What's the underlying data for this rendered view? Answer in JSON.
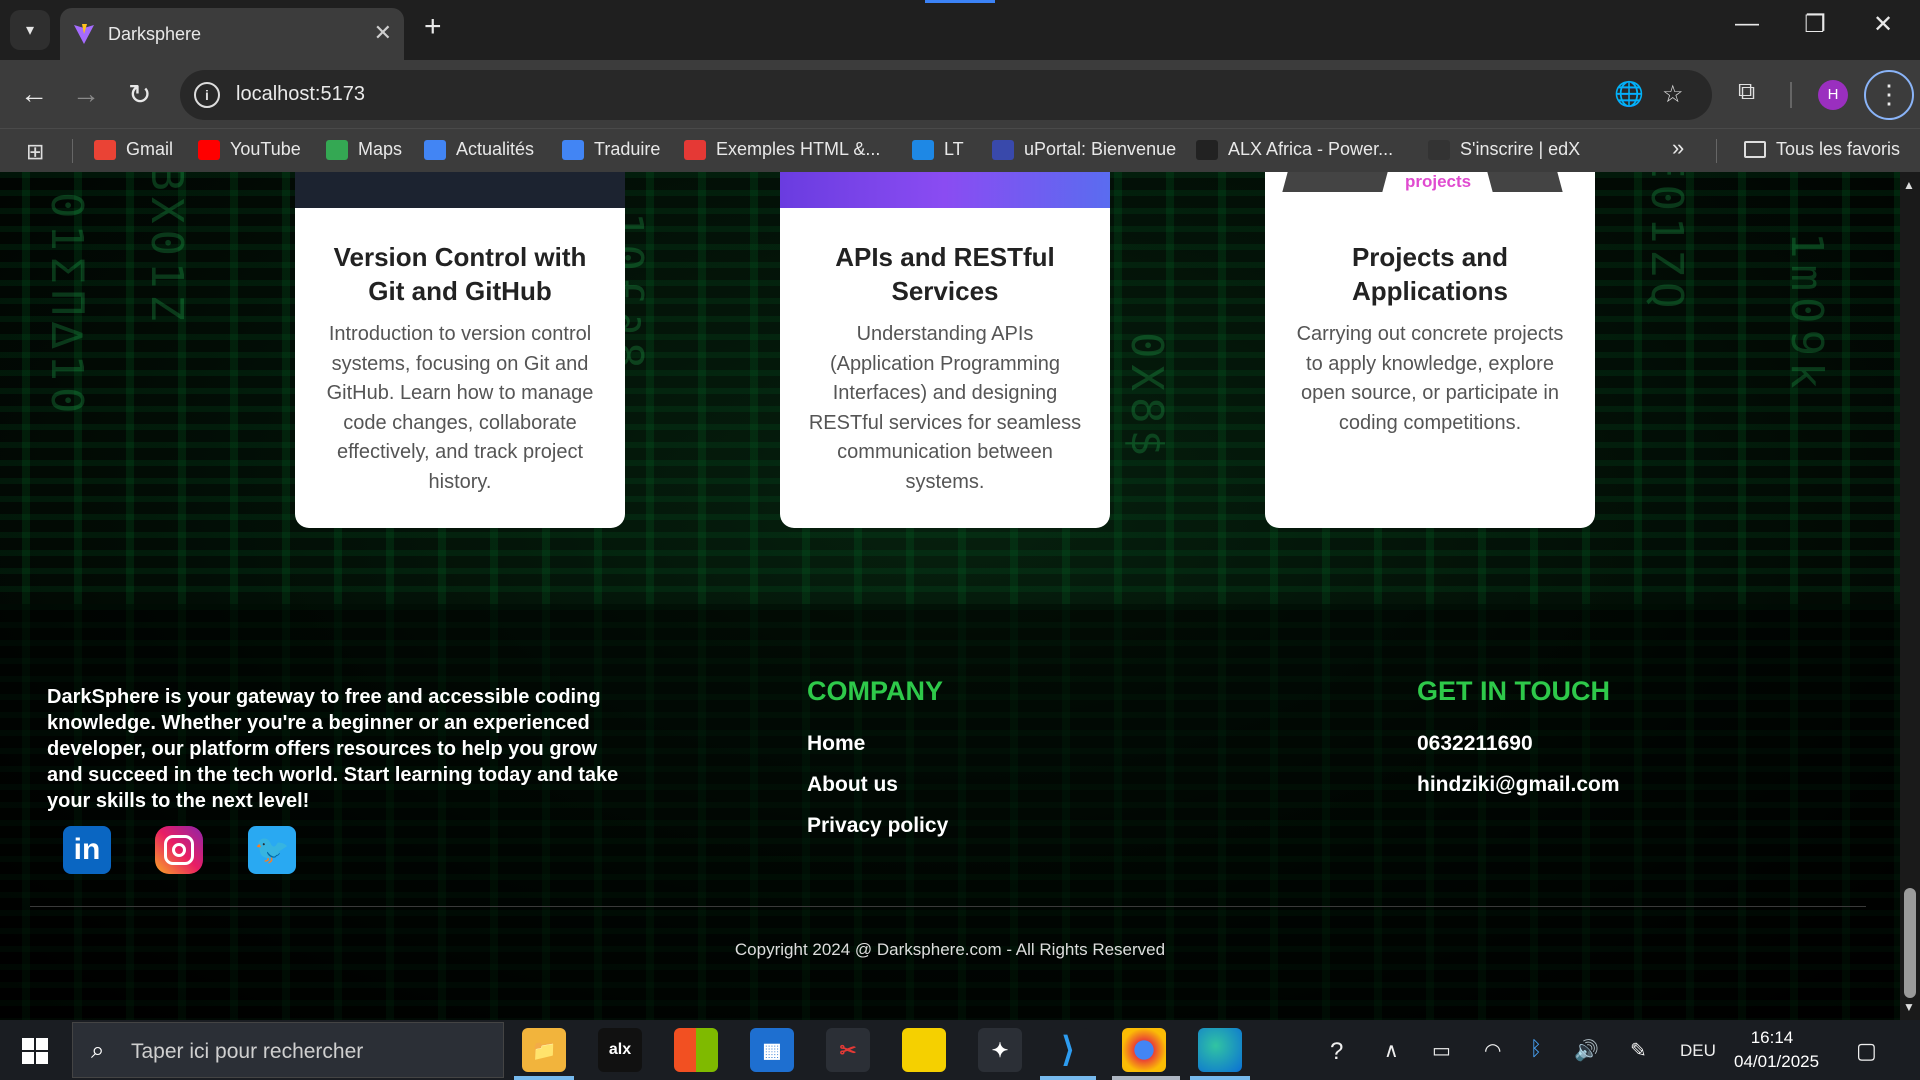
{
  "browser": {
    "tab_title": "Darksphere",
    "url": "localhost:5173",
    "avatar_letter": "H",
    "bookmarks": [
      {
        "label": "Gmail",
        "icon": "gmail-icon",
        "color": "#ea4335"
      },
      {
        "label": "YouTube",
        "icon": "youtube-icon",
        "color": "#ff0000"
      },
      {
        "label": "Maps",
        "icon": "maps-icon",
        "color": "#34a853"
      },
      {
        "label": "Actualités",
        "icon": "news-icon",
        "color": "#4285f4"
      },
      {
        "label": "Traduire",
        "icon": "translate-icon",
        "color": "#4285f4"
      },
      {
        "label": "Exemples HTML &...",
        "icon": "bookmark-red-icon",
        "color": "#e53935"
      },
      {
        "label": "LT",
        "icon": "lt-icon",
        "color": "#1e88e5"
      },
      {
        "label": "uPortal: Bienvenue",
        "icon": "uportal-icon",
        "color": "#3949ab"
      },
      {
        "label": "ALX Africa - Power...",
        "icon": "alx-icon",
        "color": "#222222"
      },
      {
        "label": "S'inscrire | edX",
        "icon": "edx-icon",
        "color": "#333333"
      }
    ],
    "overflow_label": "»",
    "all_bookmarks_label": "Tous les favoris"
  },
  "cards": [
    {
      "title": "Version Control with Git and GitHub",
      "text": "Introduction to version control systems, focusing on Git and GitHub. Learn how to manage code changes, collaborate effectively, and track project history."
    },
    {
      "title": "APIs and RESTful Services",
      "text": "Understanding APIs (Application Programming Interfaces) and designing RESTful services for seamless communication between systems."
    },
    {
      "title": "Projects and Applications",
      "text": "Carrying out concrete projects to apply knowledge, explore open source, or participate in coding competitions.",
      "image_word": "projects"
    }
  ],
  "footer": {
    "about": "DarkSphere is your gateway to free and accessible coding knowledge. Whether you're a beginner or an experienced developer, our platform offers resources to help you grow and succeed in the tech world. Start learning today and take your skills to the next level!",
    "company_heading": "COMPANY",
    "company_links": [
      "Home",
      "About us",
      "Privacy policy"
    ],
    "contact_heading": "GET IN TOUCH",
    "phone": "0632211690",
    "email": "hindziki@gmail.com",
    "copyright": "Copyright 2024 @ Darksphere.com - All Rights Reserved",
    "accent_color": "#2ec94a"
  },
  "taskbar": {
    "search_placeholder": "Taper ici pour rechercher",
    "alx_label": "alx",
    "language": "DEU",
    "time": "16:14",
    "date": "04/01/2025"
  }
}
